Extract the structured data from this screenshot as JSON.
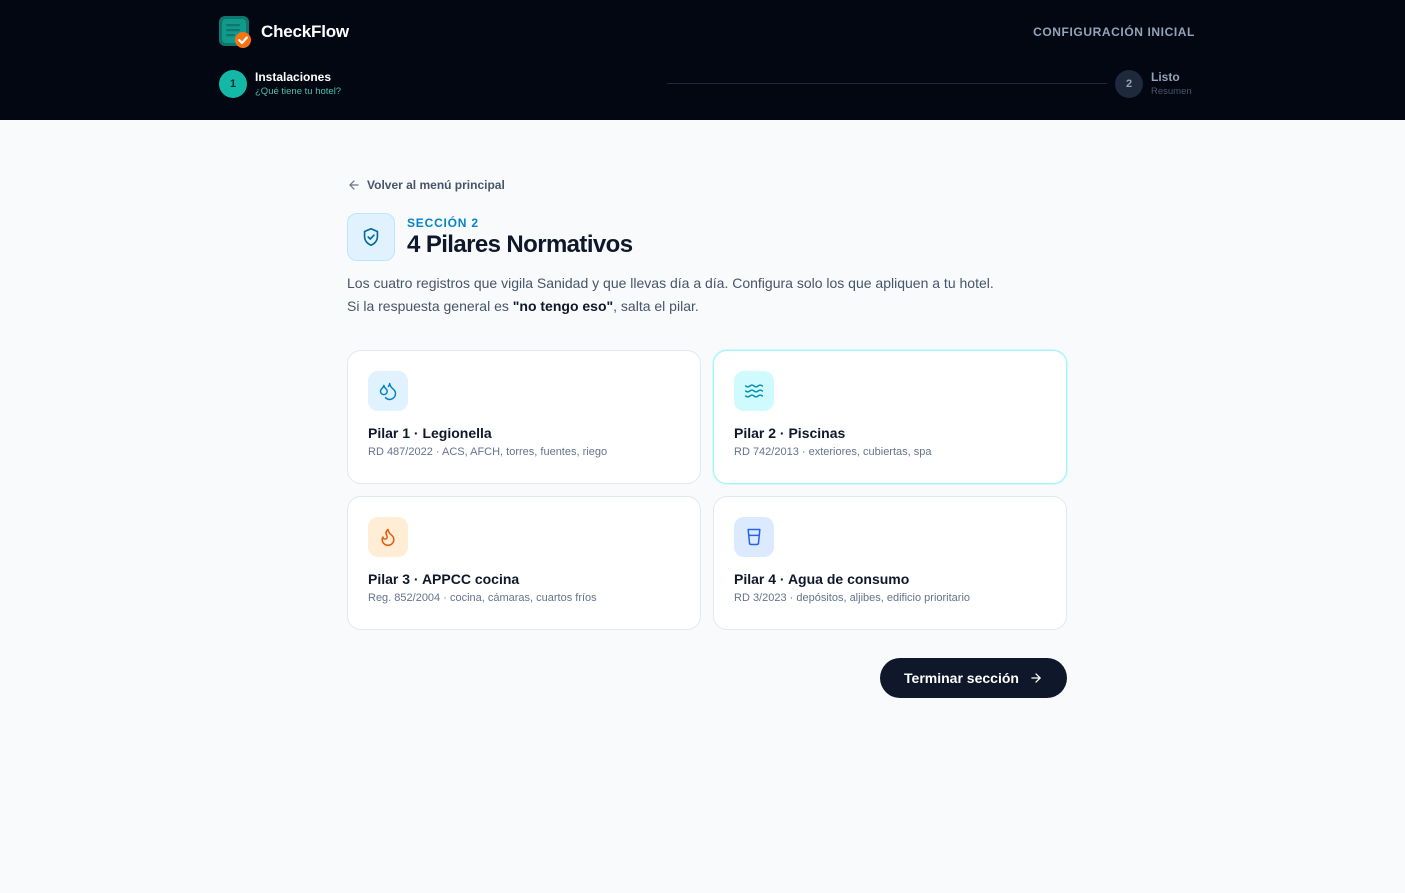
{
  "app": {
    "name": "CheckFlow",
    "setup_label": "CONFIGURACIÓN INICIAL"
  },
  "steps": [
    {
      "number": "1",
      "title": "Instalaciones",
      "subtitle": "¿Qué tiene tu hotel?",
      "state": "active"
    },
    {
      "number": "2",
      "title": "Listo",
      "subtitle": "Resumen",
      "state": "pending"
    }
  ],
  "nav": {
    "back_label": "Volver al menú principal"
  },
  "section": {
    "kicker": "SECCIÓN 2",
    "title": "4 Pilares Normativos",
    "desc_before": "Los cuatro registros que vigila Sanidad y que llevas día a día. Configura solo los que apliquen a tu hotel. Si la respuesta general es ",
    "desc_bold": "\"no tengo eso\"",
    "desc_after": ", salta el pilar."
  },
  "pillars": [
    {
      "title": "Pilar 1 · Legionella",
      "subtitle": "RD 487/2022 · ACS, AFCH, torres, fuentes, riego",
      "icon": "droplets-icon",
      "icon_bg": "#e0f2fe",
      "icon_color": "#0284c7"
    },
    {
      "title": "Pilar 2 · Piscinas",
      "subtitle": "RD 742/2013 · exteriores, cubiertas, spa",
      "icon": "waves-icon",
      "icon_bg": "#cffafe",
      "icon_color": "#0891b2",
      "selected": true
    },
    {
      "title": "Pilar 3 · APPCC cocina",
      "subtitle": "Reg. 852/2004 · cocina, cámaras, cuartos fríos",
      "icon": "flame-icon",
      "icon_bg": "#ffedd5",
      "icon_color": "#ea580c"
    },
    {
      "title": "Pilar 4 · Agua de consumo",
      "subtitle": "RD 3/2023 · depósitos, aljibes, edificio prioritario",
      "icon": "glass-icon",
      "icon_bg": "#dbeafe",
      "icon_color": "#2563eb"
    }
  ],
  "actions": {
    "finish_label": "Terminar sección"
  },
  "colors": {
    "topbar_bg": "#030712",
    "accent_teal": "#14b8a6",
    "primary_button": "#0f172a",
    "section_kicker": "#0284c7"
  }
}
